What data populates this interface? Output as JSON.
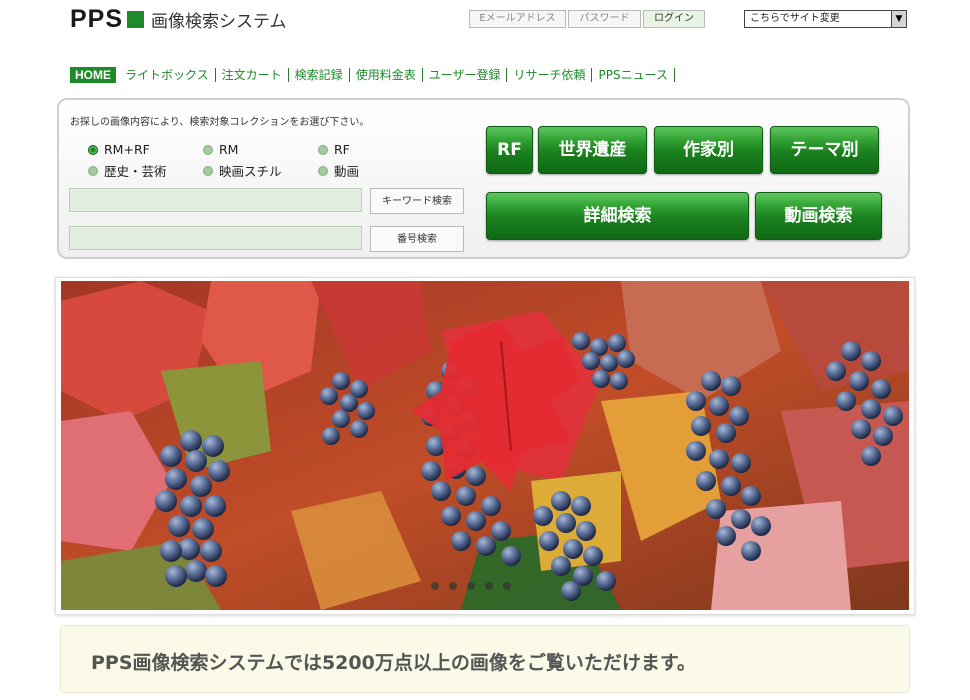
{
  "header": {
    "logo_text": "PPS",
    "logo_subtitle": "画像検索システム",
    "email_placeholder": "Eメールアドレス",
    "password_placeholder": "パスワード",
    "login_label": "ログイン",
    "site_select": "こちらでサイト変更"
  },
  "nav": {
    "home": "HOME",
    "items": [
      "ライトボックス",
      "注文カート",
      "検索記録",
      "使用料金表",
      "ユーザー登録",
      "リサーチ依頼",
      "PPSニュース"
    ]
  },
  "search": {
    "intro": "お探しの画像内容により、検索対象コレクションをお選び下さい。",
    "options": [
      "RM+RF",
      "RM",
      "RF",
      "歴史・芸術",
      "映画スチル",
      "動画"
    ],
    "selected": "RM+RF",
    "keyword_button": "キーワード検索",
    "number_button": "番号検索"
  },
  "buttons": {
    "rf": "RF",
    "heritage": "世界遺産",
    "artist": "作家別",
    "theme": "テーマ別",
    "detail": "詳細検索",
    "video": "動画検索"
  },
  "banner": {
    "description_icon": "grapes-photo"
  },
  "message": "PPS画像検索システムでは5200万点以上の画像をご覧いただけます。",
  "colors": {
    "brand_green": "#1e8a2a",
    "panel_border": "#cfcfcf",
    "message_bg": "#fbfae8"
  }
}
